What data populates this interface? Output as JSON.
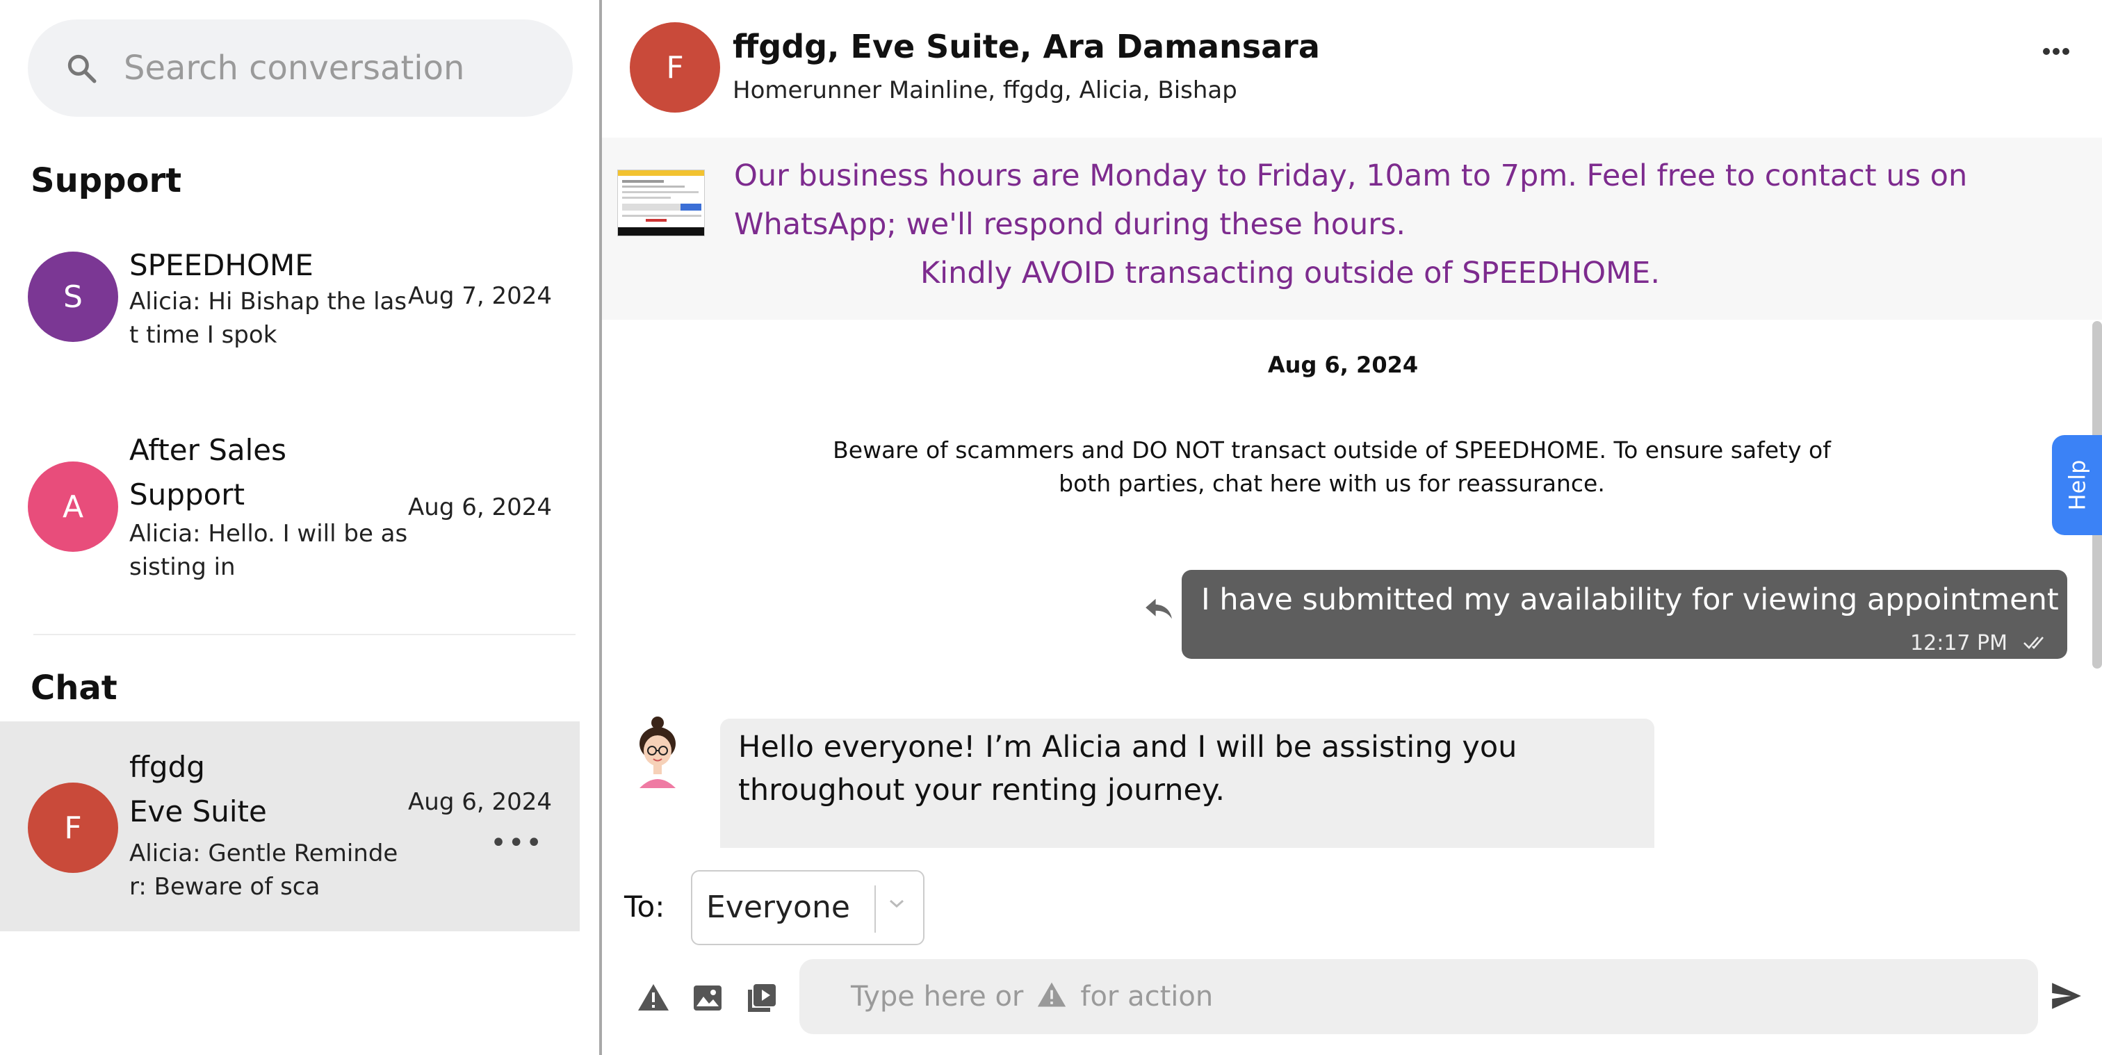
{
  "sidebar": {
    "search_placeholder": "Search conversation",
    "support_title": "Support",
    "chat_title": "Chat",
    "support_items": [
      {
        "initial": "S",
        "name": "SPEEDHOME",
        "preview": "Alicia: Hi Bishap the last time I spok",
        "date": "Aug 7, 2024",
        "color": "#7b3794"
      },
      {
        "initial": "A",
        "name_line1": "After Sales",
        "name_line2": "Support",
        "preview": "Alicia: Hello. I will be assisting in",
        "date": "Aug 6, 2024",
        "color": "#e84d7b"
      }
    ],
    "chat_items": [
      {
        "initial": "F",
        "name_line1": "ffgdg",
        "name_line2": "Eve Suite",
        "preview": "Alicia: Gentle Reminder: Beware of sca",
        "date": "Aug 6, 2024",
        "color": "#c94a3a"
      }
    ]
  },
  "header": {
    "initial": "F",
    "title": "ffgdg, Eve Suite, Ara Damansara",
    "participants": "Homerunner Mainline, ffgdg, Alicia, Bishap"
  },
  "banner": {
    "line1": "Our business hours are Monday to Friday, 10am to 7pm. Feel free to contact us on",
    "line2": "WhatsApp; we'll respond during these hours.",
    "line3": "Kindly AVOID transacting outside of SPEEDHOME."
  },
  "messages": {
    "date_separator": "Aug 6, 2024",
    "system_note": "Beware of scammers and DO NOT transact outside of SPEEDHOME. To ensure safety of both parties, chat here with us for reassurance.",
    "outgoing": {
      "text": "I have submitted my availability for viewing appointment",
      "time": "12:17 PM"
    },
    "incoming": {
      "text": "Hello everyone! I’m Alicia and I will be assisting you throughout your renting journey."
    }
  },
  "help_label": "Help",
  "recipient": {
    "label": "To:",
    "selected": "Everyone"
  },
  "composer": {
    "placeholder_part1": "Type here or",
    "placeholder_part2": "for action"
  },
  "colors": {
    "banner_text": "#7d2b8e",
    "outgoing_bubble": "#5e5e5e",
    "help_tab": "#3b82f6"
  }
}
